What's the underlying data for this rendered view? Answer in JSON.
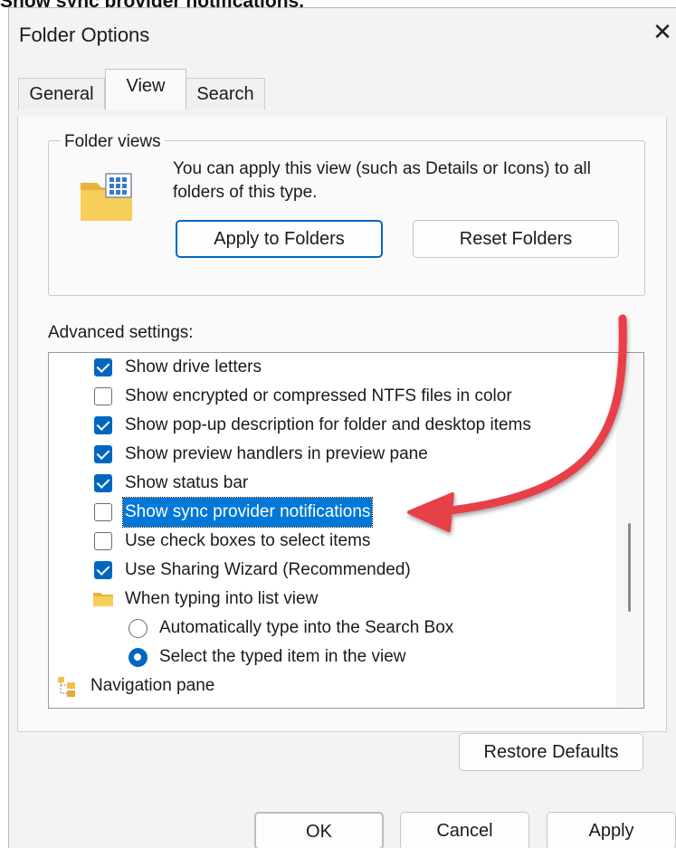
{
  "caption": "Show sync provider notifications.",
  "window": {
    "title": "Folder Options",
    "close_glyph": "✕"
  },
  "tabs": [
    {
      "label": "General",
      "active": false
    },
    {
      "label": "View",
      "active": true
    },
    {
      "label": "Search",
      "active": false
    }
  ],
  "folder_views": {
    "group_label": "Folder views",
    "icon": "folder-view-icon",
    "description": "You can apply this view (such as Details or Icons) to all folders of this type.",
    "apply_button": "Apply to Folders",
    "reset_button": "Reset Folders"
  },
  "advanced": {
    "label": "Advanced settings:",
    "items": [
      {
        "type": "checkbox",
        "checked": true,
        "label": "Show drive letters"
      },
      {
        "type": "checkbox",
        "checked": false,
        "label": "Show encrypted or compressed NTFS files in color"
      },
      {
        "type": "checkbox",
        "checked": true,
        "label": "Show pop-up description for folder and desktop items"
      },
      {
        "type": "checkbox",
        "checked": true,
        "label": "Show preview handlers in preview pane"
      },
      {
        "type": "checkbox",
        "checked": true,
        "label": "Show status bar"
      },
      {
        "type": "checkbox",
        "checked": false,
        "selected": true,
        "label": "Show sync provider notifications"
      },
      {
        "type": "checkbox",
        "checked": false,
        "label": "Use check boxes to select items"
      },
      {
        "type": "checkbox",
        "checked": true,
        "label": "Use Sharing Wizard (Recommended)"
      },
      {
        "type": "folder",
        "label": "When typing into list view"
      },
      {
        "type": "radio",
        "checked": false,
        "label": "Automatically type into the Search Box"
      },
      {
        "type": "radio",
        "checked": true,
        "label": "Select the typed item in the view"
      },
      {
        "type": "group",
        "label": "Navigation pane"
      }
    ]
  },
  "restore_button": "Restore Defaults",
  "footer": {
    "ok": "OK",
    "cancel": "Cancel",
    "apply": "Apply"
  },
  "colors": {
    "accent": "#0067c0",
    "selection": "#0078d7",
    "annotation_arrow": "#e8404a"
  }
}
